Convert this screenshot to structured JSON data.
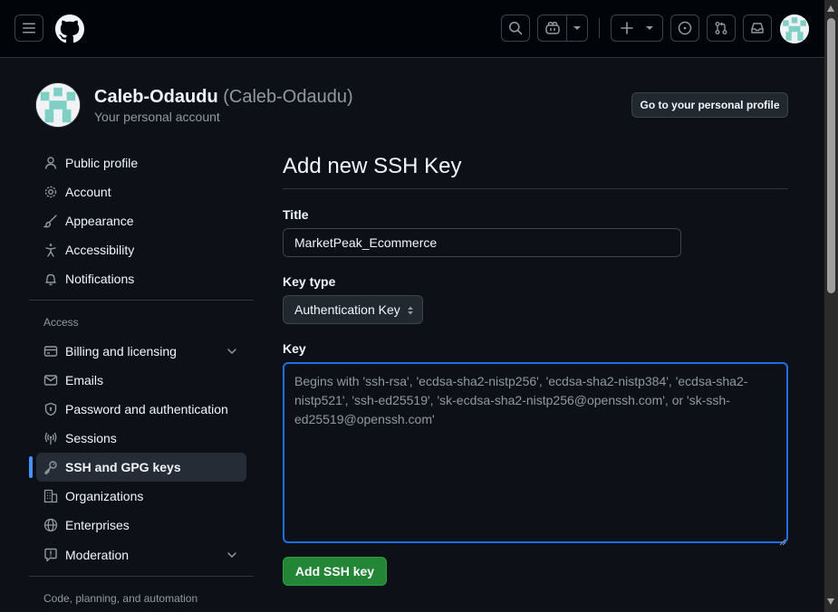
{
  "header": {
    "menu_icon": "hamburger-icon",
    "logo_icon": "github-logo-icon",
    "search_icon": "search-icon",
    "copilot_icon": "copilot-icon",
    "create_icon": "plus-icon",
    "issues_icon": "issue-opened-icon",
    "pulls_icon": "git-pull-request-icon",
    "inbox_icon": "inbox-icon"
  },
  "profile": {
    "name": "Caleb-Odaudu",
    "login": "(Caleb-Odaudu)",
    "subtitle": "Your personal account",
    "go_to_profile": "Go to your personal profile"
  },
  "sidebar": {
    "items": [
      {
        "label": "Public profile",
        "icon": "person-icon"
      },
      {
        "label": "Account",
        "icon": "gear-icon"
      },
      {
        "label": "Appearance",
        "icon": "paintbrush-icon"
      },
      {
        "label": "Accessibility",
        "icon": "accessibility-icon"
      },
      {
        "label": "Notifications",
        "icon": "bell-icon"
      }
    ],
    "access_heading": "Access",
    "access_items": [
      {
        "label": "Billing and licensing",
        "icon": "credit-card-icon",
        "expandable": true
      },
      {
        "label": "Emails",
        "icon": "mail-icon"
      },
      {
        "label": "Password and authentication",
        "icon": "shield-lock-icon"
      },
      {
        "label": "Sessions",
        "icon": "broadcast-icon"
      },
      {
        "label": "SSH and GPG keys",
        "icon": "key-icon",
        "active": true
      },
      {
        "label": "Organizations",
        "icon": "organization-icon"
      },
      {
        "label": "Enterprises",
        "icon": "globe-icon"
      },
      {
        "label": "Moderation",
        "icon": "report-icon",
        "expandable": true
      }
    ],
    "code_heading": "Code, planning, and automation"
  },
  "main": {
    "title": "Add new SSH Key",
    "title_label": "Title",
    "title_value": "MarketPeak_Ecommerce",
    "keytype_label": "Key type",
    "keytype_value": "Authentication Key",
    "key_label": "Key",
    "key_placeholder": "Begins with 'ssh-rsa', 'ecdsa-sha2-nistp256', 'ecdsa-sha2-nistp384', 'ecdsa-sha2-nistp521', 'ssh-ed25519', 'sk-ecdsa-sha2-nistp256@openssh.com', or 'sk-ssh-ed25519@openssh.com'",
    "submit_label": "Add SSH key"
  },
  "colors": {
    "background": "#0d1117",
    "header_bg": "#010409",
    "accent_blue": "#1f6feb",
    "success_green": "#238636"
  }
}
